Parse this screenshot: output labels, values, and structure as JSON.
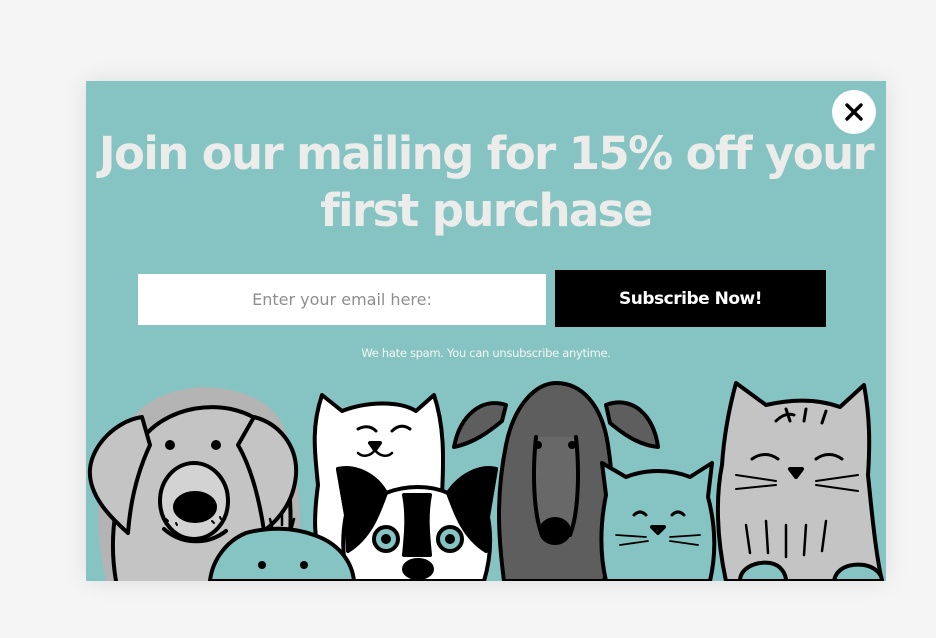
{
  "popup": {
    "headline": "Join our mailing for 15% off your first purchase",
    "email_placeholder": "Enter your email here:",
    "subscribe_label": "Subscribe Now!",
    "spam_note": "We hate spam. You can unsubscribe anytime.",
    "close_icon": "close-icon",
    "colors": {
      "background": "#85c4c2",
      "button": "#000000",
      "headline": "#ecedea"
    }
  },
  "illustration": {
    "animals": [
      "labrador-dog",
      "white-cat",
      "puppy",
      "boston-terrier",
      "greyhound-dog",
      "kitten",
      "tabby-cat"
    ]
  }
}
